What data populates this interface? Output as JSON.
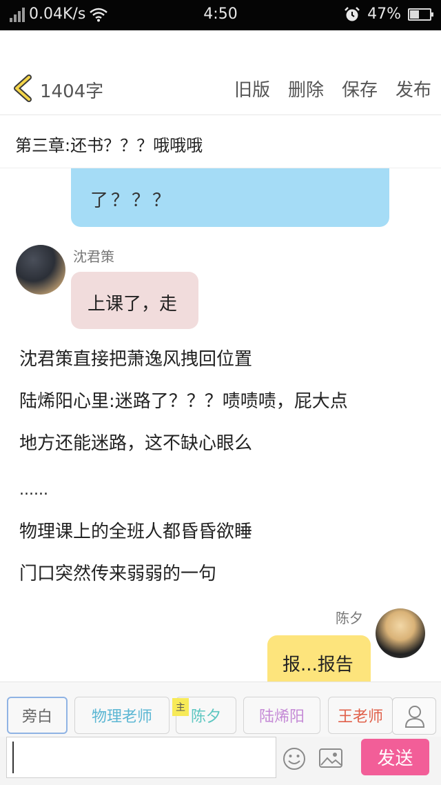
{
  "status_bar": {
    "network_speed": "0.04K/s",
    "time": "4:50",
    "battery_percent": "47%",
    "battery_level": 0.47
  },
  "header": {
    "word_count": "1404字",
    "actions": [
      "旧版",
      "删除",
      "保存",
      "发布"
    ]
  },
  "chapter": {
    "title": "第三章:还书？？？哦哦哦"
  },
  "story": {
    "bubble_top_text": "了？？？",
    "msg1_speaker": "沈君策",
    "msg1_text": "上课了，走",
    "paragraphs": [
      "沈君策直接把萧逸风拽回位置",
      "陆烯阳心里:迷路了？？？啧啧啧，屁大点",
      "地方还能迷路，这不缺心眼么",
      "......",
      "物理课上的全班人都昏昏欲睡",
      "门口突然传来弱弱的一句"
    ],
    "msg2_speaker": "陈夕",
    "msg2_text": "报...报告"
  },
  "characters": {
    "narration": "旁白",
    "teacher": "物理老师",
    "chenxi": "陈夕",
    "main_badge": "主",
    "luxiyang": "陆烯阳",
    "wang": "王老师"
  },
  "input": {
    "value": "",
    "send_label": "发送"
  },
  "colors": {
    "blue_bubble": "#a5dcf6",
    "pink_bubble": "#f1dcdc",
    "yellow_bubble": "#fde47c",
    "send_button": "#f25e98"
  }
}
